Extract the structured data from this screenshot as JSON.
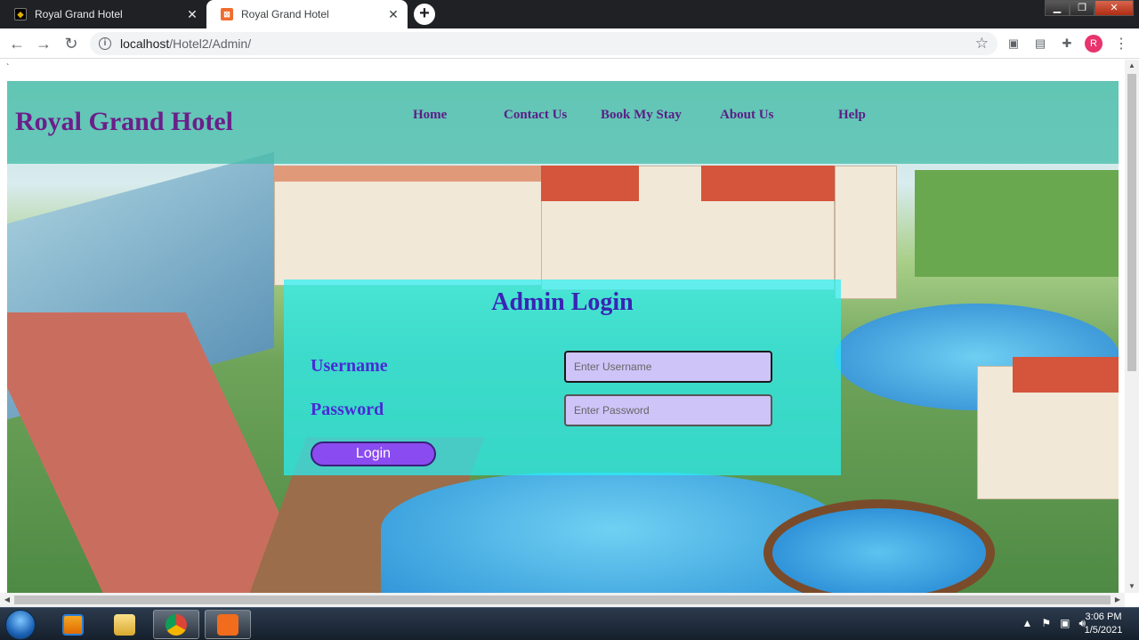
{
  "browser": {
    "tabs": [
      {
        "title": "Royal Grand Hotel"
      },
      {
        "title": "Royal Grand Hotel"
      }
    ],
    "url_host": "localhost",
    "url_path": "/Hotel2/Admin/",
    "avatar_letter": "R"
  },
  "page": {
    "stray_char": "`",
    "site_title": "Royal Grand Hotel",
    "nav": [
      "Home",
      "Contact Us",
      "Book My Stay",
      "About Us",
      "Help"
    ],
    "login": {
      "title": "Admin Login",
      "username_label": "Username",
      "username_placeholder": "Enter Username",
      "password_label": "Password",
      "password_placeholder": "Enter Password",
      "button_label": "Login"
    }
  },
  "taskbar": {
    "time": "3:06 PM",
    "date": "1/5/2021"
  },
  "colors": {
    "header_band": "#48beaa",
    "title_purple": "#6b1f8a",
    "login_panel": "#28f0f5",
    "button": "#8a4cf0"
  }
}
